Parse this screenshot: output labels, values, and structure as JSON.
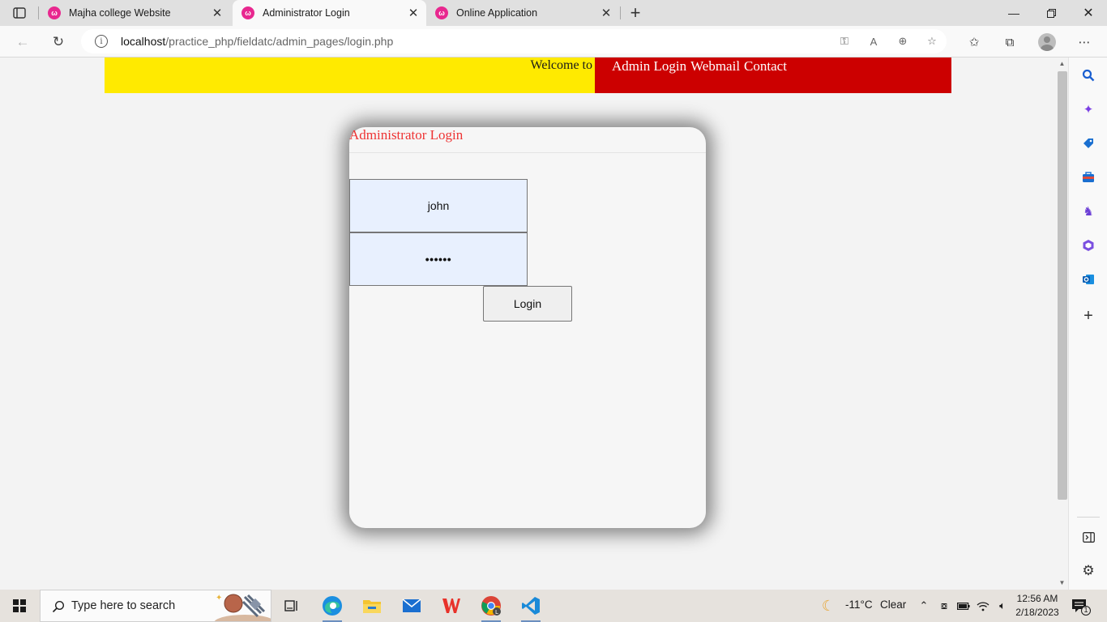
{
  "browser": {
    "tabs": [
      {
        "title": "Majha college Website",
        "active": false
      },
      {
        "title": "Administrator Login",
        "active": true
      },
      {
        "title": "Online Application",
        "active": false
      }
    ],
    "url_host": "localhost",
    "url_path": "/practice_php/fieldatc/admin_pages/login.php"
  },
  "page": {
    "welcome_text": "Welcome to",
    "nav_links": [
      "Admin Login",
      "Webmail",
      "Contact"
    ],
    "login": {
      "title": "Administrator Login",
      "username_value": "john",
      "password_value": "••••••",
      "button_label": "Login"
    }
  },
  "colors": {
    "header_yellow": "#ffea00",
    "nav_red": "#cc0000",
    "title_red": "#ee3333",
    "favicon_pink": "#e8288f",
    "autofill_blue": "#e8f0fe"
  },
  "taskbar": {
    "search_placeholder": "Type here to search",
    "weather_temp": "-11°C",
    "weather_desc": "Clear",
    "time": "12:56 AM",
    "date": "2/18/2023",
    "notification_count": "1"
  }
}
